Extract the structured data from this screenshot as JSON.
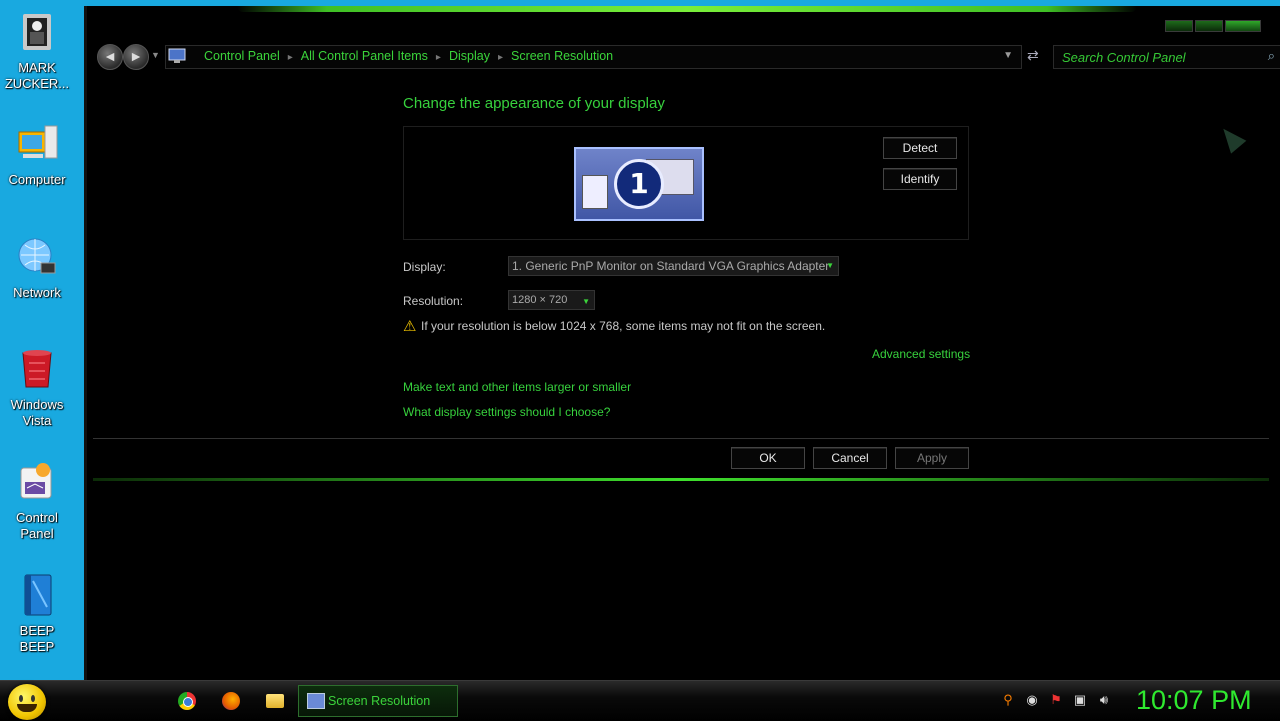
{
  "desktop": {
    "icons": [
      {
        "label": "MARK ZUCKER...",
        "icon": "user-folder-icon"
      },
      {
        "label": "Computer",
        "icon": "computer-icon"
      },
      {
        "label": "Network",
        "icon": "network-globe-icon"
      },
      {
        "label": "Windows Vista",
        "icon": "recycle-bin-icon"
      },
      {
        "label": "Control Panel",
        "icon": "control-panel-icon"
      },
      {
        "label": "BEEP BEEP",
        "icon": "blue-book-icon"
      }
    ]
  },
  "window": {
    "nav": {
      "back_glyph": "◄",
      "forward_glyph": "►",
      "breadcrumbs": [
        "Control Panel",
        "All Control Panel Items",
        "Display",
        "Screen Resolution"
      ],
      "search_placeholder": "Search Control Panel"
    },
    "heading": "Change the appearance of your display",
    "monitor_number": "1",
    "buttons": {
      "detect": "Detect",
      "identify": "Identify",
      "ok": "OK",
      "cancel": "Cancel",
      "apply": "Apply"
    },
    "display": {
      "label": "Display:",
      "value": "1. Generic PnP Monitor on Standard VGA Graphics Adapter"
    },
    "resolution": {
      "label": "Resolution:",
      "value": "1280 × 720"
    },
    "warning": "If your resolution is below 1024 x 768, some items may not fit on the screen.",
    "links": {
      "advanced": "Advanced settings",
      "text_size": "Make text and other items larger or smaller",
      "help": "What display settings should I choose?"
    }
  },
  "taskbar": {
    "active_task": "Screen Resolution",
    "clock": "10:07 PM"
  },
  "colors": {
    "accent_green": "#37d13d",
    "desktop_bg": "#19a9e0",
    "window_bg": "#000000"
  }
}
